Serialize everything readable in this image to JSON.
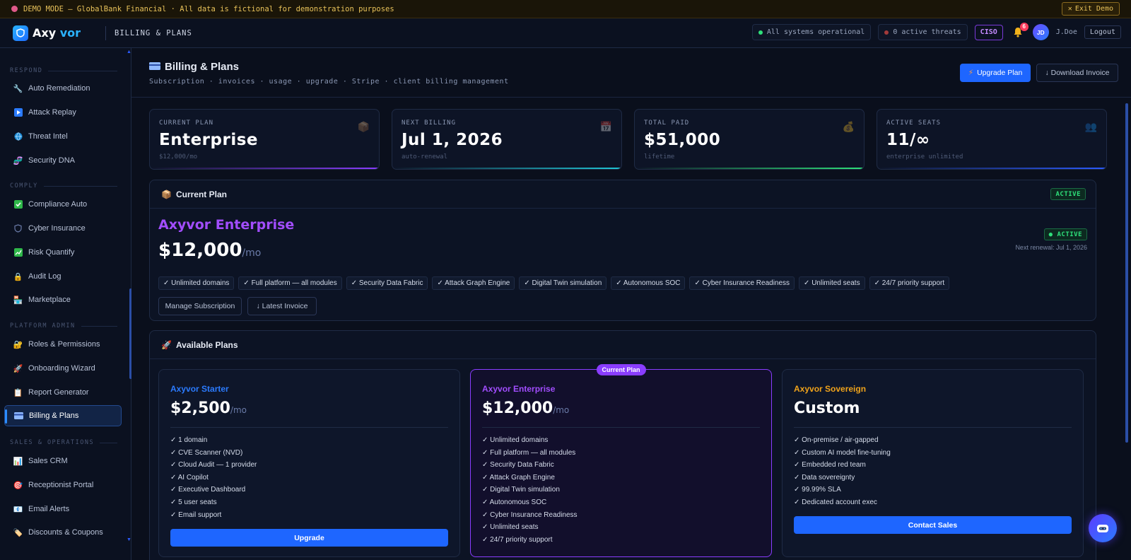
{
  "banner": {
    "text": "DEMO MODE — GlobalBank Financial · All data is fictional for demonstration purposes",
    "exit_label": "Exit Demo"
  },
  "topbar": {
    "logo_a": "Axy",
    "logo_b": "vor",
    "crumb": "BILLING & PLANS",
    "status": "All systems operational",
    "threats": "0 active threats",
    "role": "CISO",
    "notifications": "6",
    "avatar_initials": "JD",
    "username": "J.Doe",
    "logout": "Logout"
  },
  "sidebar": {
    "sections": [
      {
        "label": "RESPOND"
      },
      {
        "label": "COMPLY"
      },
      {
        "label": "PLATFORM ADMIN"
      },
      {
        "label": "SALES & OPERATIONS"
      }
    ],
    "items": [
      {
        "label": "Auto Remediation",
        "icon": "wrench-icon"
      },
      {
        "label": "Attack Replay",
        "icon": "play-icon"
      },
      {
        "label": "Threat Intel",
        "icon": "globe-icon"
      },
      {
        "label": "Security DNA",
        "icon": "dna-icon"
      },
      {
        "label": "Compliance Auto",
        "icon": "check-icon"
      },
      {
        "label": "Cyber Insurance",
        "icon": "shield-icon"
      },
      {
        "label": "Risk Quantify",
        "icon": "chart-icon"
      },
      {
        "label": "Audit Log",
        "icon": "lock-icon"
      },
      {
        "label": "Marketplace",
        "icon": "store-icon"
      },
      {
        "label": "Roles & Permissions",
        "icon": "key-lock-icon"
      },
      {
        "label": "Onboarding Wizard",
        "icon": "rocket-icon"
      },
      {
        "label": "Report Generator",
        "icon": "clipboard-icon"
      },
      {
        "label": "Billing & Plans",
        "icon": "card-icon"
      },
      {
        "label": "Sales CRM",
        "icon": "bar-chart-icon"
      },
      {
        "label": "Receptionist Portal",
        "icon": "target-icon"
      },
      {
        "label": "Email Alerts",
        "icon": "mail-icon"
      },
      {
        "label": "Discounts & Coupons",
        "icon": "tag-icon"
      }
    ]
  },
  "page": {
    "title": "Billing & Plans",
    "subtitle": "Subscription · invoices · usage · upgrade · Stripe · client billing management",
    "upgrade_label": "Upgrade Plan",
    "download_label": "↓ Download Invoice"
  },
  "stats": [
    {
      "label": "CURRENT PLAN",
      "value": "Enterprise",
      "sub": "$12,000/mo",
      "icon": "box-icon",
      "color": "#8a3dff"
    },
    {
      "label": "NEXT BILLING",
      "value": "Jul 1, 2026",
      "sub": "auto-renewal",
      "icon": "calendar-icon",
      "color": "#1fc6d6"
    },
    {
      "label": "TOTAL PAID",
      "value": "$51,000",
      "sub": "lifetime",
      "icon": "money-bag-icon",
      "color": "#2ee07a"
    },
    {
      "label": "ACTIVE SEATS",
      "value": "11/∞",
      "sub": "enterprise unlimited",
      "icon": "users-icon",
      "color": "#2b5bff"
    }
  ],
  "current_plan": {
    "heading": "Current Plan",
    "status": "ACTIVE",
    "name": "Axyvor Enterprise",
    "price": "$12,000",
    "per": "/mo",
    "status_dot": "● ACTIVE",
    "renewal": "Next renewal: Jul 1, 2026",
    "features": [
      "✓ Unlimited domains",
      "✓ Full platform — all modules",
      "✓ Security Data Fabric",
      "✓ Attack Graph Engine",
      "✓ Digital Twin simulation",
      "✓ Autonomous SOC",
      "✓ Cyber Insurance Readiness",
      "✓ Unlimited seats",
      "✓ 24/7 priority support"
    ],
    "manage_label": "Manage Subscription",
    "latest_label": "↓ Latest Invoice"
  },
  "available": {
    "heading": "Available Plans",
    "current_tag": "Current Plan",
    "tiers": [
      {
        "name": "Axyvor Starter",
        "price": "$2,500",
        "per": "/mo",
        "color": "#2b7bff",
        "features": [
          "✓ 1 domain",
          "✓ CVE Scanner (NVD)",
          "✓ Cloud Audit — 1 provider",
          "✓ AI Copilot",
          "✓ Executive Dashboard",
          "✓ 5 user seats",
          "✓ Email support"
        ],
        "button": "Upgrade"
      },
      {
        "name": "Axyvor Enterprise",
        "price": "$12,000",
        "per": "/mo",
        "color": "#a24dff",
        "features": [
          "✓ Unlimited domains",
          "✓ Full platform — all modules",
          "✓ Security Data Fabric",
          "✓ Attack Graph Engine",
          "✓ Digital Twin simulation",
          "✓ Autonomous SOC",
          "✓ Cyber Insurance Readiness",
          "✓ Unlimited seats",
          "✓ 24/7 priority support"
        ],
        "button": ""
      },
      {
        "name": "Axyvor Sovereign",
        "price": "Custom",
        "per": "",
        "color": "#f0a31b",
        "features": [
          "✓ On-premise / air-gapped",
          "✓ Custom AI model fine-tuning",
          "✓ Embedded red team",
          "✓ Data sovereignty",
          "✓ 99.99% SLA",
          "✓ Dedicated account exec"
        ],
        "button": "Contact Sales"
      }
    ]
  }
}
